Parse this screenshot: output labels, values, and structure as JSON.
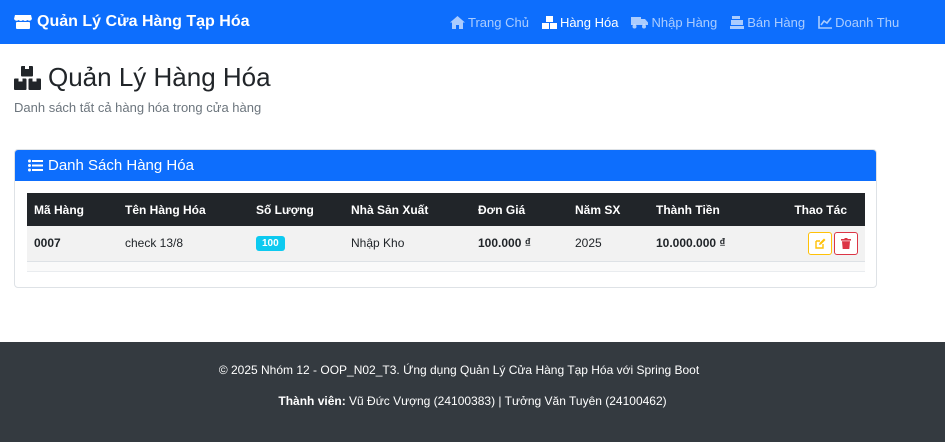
{
  "navbar": {
    "brand": "Quản Lý Cửa Hàng Tạp Hóa",
    "items": [
      {
        "label": "Trang Chủ",
        "active": false
      },
      {
        "label": "Hàng Hóa",
        "active": true
      },
      {
        "label": "Nhập Hàng",
        "active": false
      },
      {
        "label": "Bán Hàng",
        "active": false
      },
      {
        "label": "Doanh Thu",
        "active": false
      }
    ]
  },
  "header": {
    "title": "Quản Lý Hàng Hóa",
    "subtitle": "Danh sách tất cả hàng hóa trong cửa hàng"
  },
  "card": {
    "title": "Danh Sách Hàng Hóa",
    "columns": [
      "Mã Hàng",
      "Tên Hàng Hóa",
      "Số Lượng",
      "Nhà Sản Xuất",
      "Đơn Giá",
      "Năm SX",
      "Thành Tiền",
      "Thao Tác"
    ],
    "rows": [
      {
        "code": "0007",
        "name": "check 13/8",
        "quantity": "100",
        "maker": "Nhập Kho",
        "price": "100.000 ₫",
        "year": "2025",
        "total": "10.000.000 ₫"
      }
    ]
  },
  "footer": {
    "line1": "© 2025 Nhóm 12 - OOP_N02_T3. Ứng dụng Quản Lý Cửa Hàng Tạp Hóa với Spring Boot",
    "members_label": "Thành viên:",
    "members": "Vũ Đức Vượng (24100383) | Tưởng Văn Tuyên (24100462)"
  },
  "colors": {
    "primary": "#0d6efd",
    "dark": "#212529",
    "footer": "#343a40",
    "badge": "#0dcaf0",
    "warning": "#ffc107",
    "danger": "#dc3545"
  },
  "icons": {
    "brand": "store-icon",
    "home": "home-icon",
    "goods": "boxes-icon",
    "import": "truck-icon",
    "sales": "cash-register-icon",
    "revenue": "chart-line-icon",
    "list": "list-icon",
    "edit": "edit-icon",
    "delete": "trash-icon"
  }
}
